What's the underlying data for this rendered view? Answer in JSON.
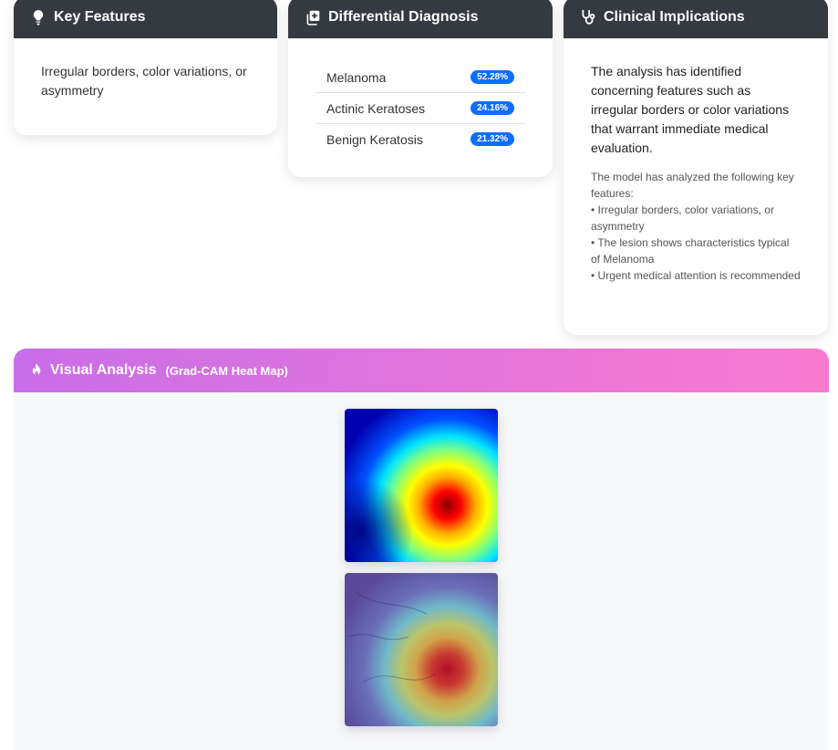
{
  "key_features": {
    "title": "Key Features",
    "icon": "lightbulb-icon",
    "text": "Irregular borders, color variations, or asymmetry"
  },
  "differential": {
    "title": "Differential Diagnosis",
    "icon": "medical-copy-icon",
    "items": [
      {
        "label": "Melanoma",
        "value": "52.28%"
      },
      {
        "label": "Actinic Keratoses",
        "value": "24.16%"
      },
      {
        "label": "Benign Keratosis",
        "value": "21.32%"
      }
    ]
  },
  "clinical": {
    "title": "Clinical Implications",
    "icon": "stethoscope-icon",
    "main": "The analysis has identified concerning features such as irregular borders or color variations that warrant immediate medical evaluation.",
    "sub_intro": "The model has analyzed the following key features:",
    "bullets": [
      "• Irregular borders, color variations, or asymmetry",
      "• The lesion shows characteristics typical of Melanoma",
      "• Urgent medical attention is recommended"
    ]
  },
  "visual": {
    "title": "Visual Analysis",
    "subtitle": "(Grad-CAM Heat Map)",
    "icon": "fire-icon",
    "accent_start": "#c86ee8",
    "accent_end": "#f97bcf"
  }
}
